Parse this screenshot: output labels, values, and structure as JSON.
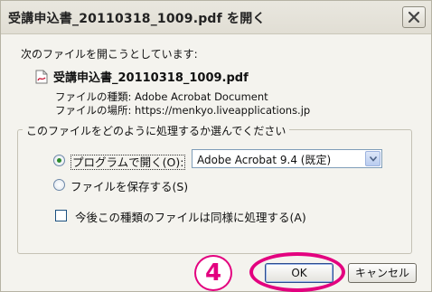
{
  "window": {
    "title": "受講申込書_20110318_1009.pdf を開く"
  },
  "intro": "次のファイルを開こうとしています:",
  "file": {
    "name": "受講申込書_20110318_1009.pdf",
    "type_label": "ファイルの種類:",
    "type_value": "Adobe Acrobat Document",
    "location_label": "ファイルの場所:",
    "location_value": "https://menkyo.liveapplications.jp"
  },
  "group_label": "このファイルをどのように処理するか選んでください",
  "options": {
    "open_with_label": "プログラムで開く(O):",
    "open_with_selected": true,
    "app_selected": "Adobe Acrobat 9.4 (既定)",
    "save_file_label": "ファイルを保存する(S)",
    "always_label": "今後この種類のファイルは同様に処理する(A)",
    "always_checked": false
  },
  "annotation": {
    "step_number": "4"
  },
  "buttons": {
    "ok": "OK",
    "cancel": "キャンセル"
  },
  "colors": {
    "annotation_accent": "#e3007f",
    "dialog_background": "#f4f3ee"
  },
  "icons": {
    "file": "pdf-file-icon",
    "close": "close-icon",
    "dropdown": "chevron-down-icon"
  }
}
